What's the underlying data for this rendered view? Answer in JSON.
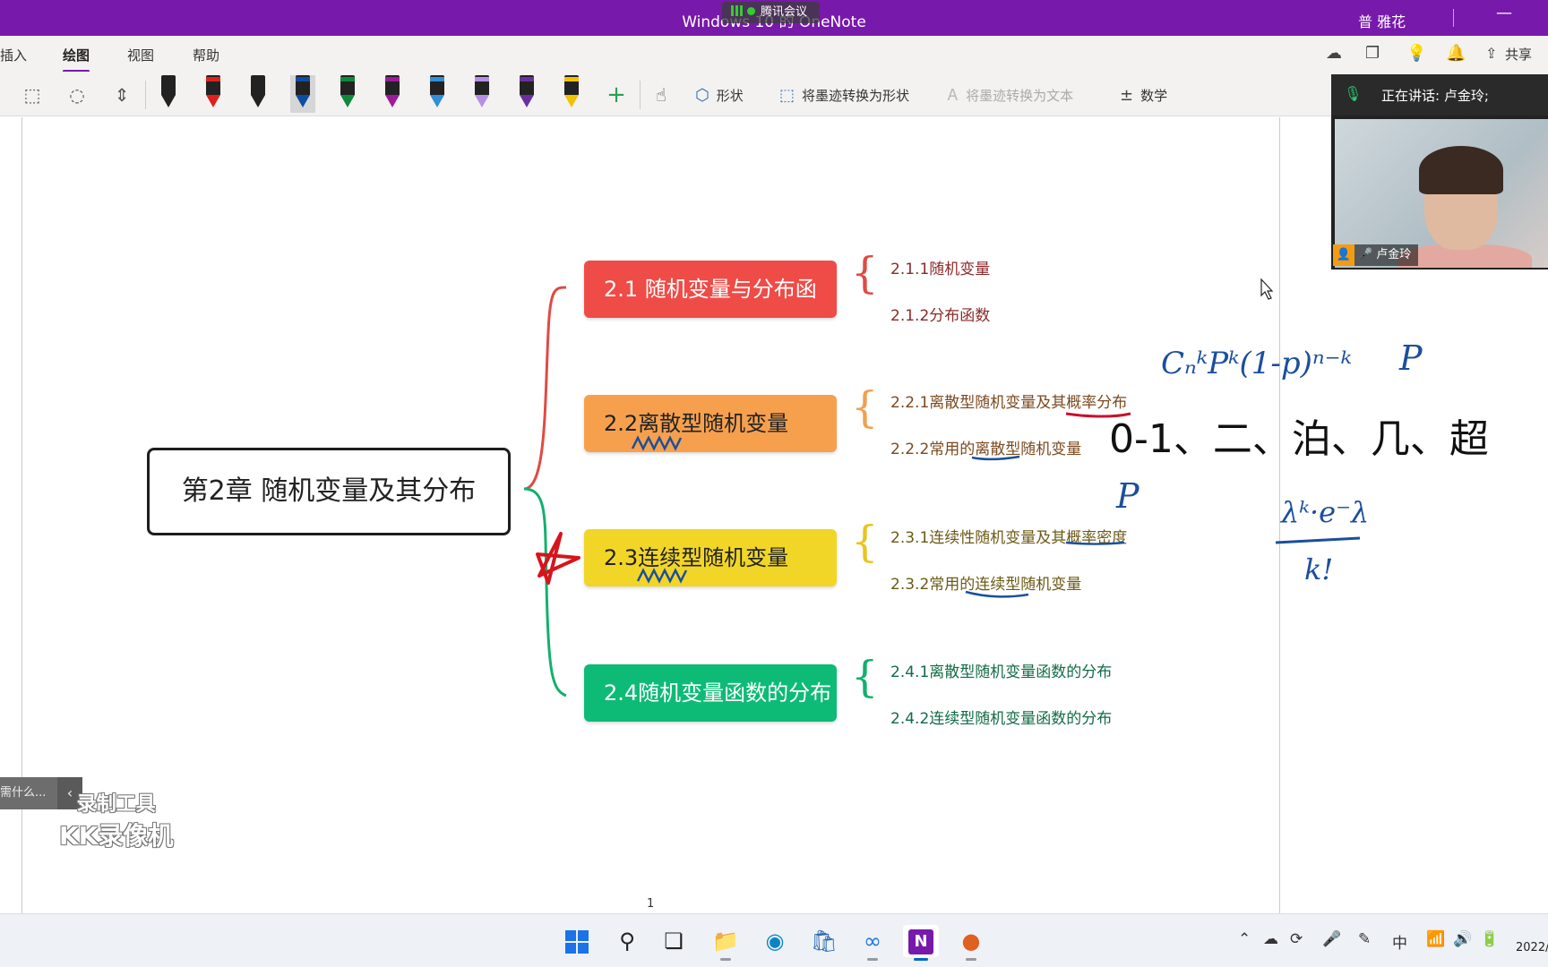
{
  "window": {
    "title": "Windows 10 的 OneNote",
    "meeting_badge": "腾讯会议",
    "user_name": "普 雅花",
    "minimize_icon": "minimize-icon"
  },
  "menu": {
    "tabs": [
      "插入",
      "绘图",
      "视图",
      "帮助"
    ],
    "active_tab": "绘图",
    "share_label": "共享"
  },
  "ribbon": {
    "pen_colors": [
      "#222222",
      "#e0201c",
      "#222222",
      "#0b4fa3",
      "#0e8a3a",
      "#9b1b9b",
      "#2f8fd8",
      "#b78ee6",
      "#6b2fa0",
      "#f2c200"
    ],
    "selected_pen_index": 3,
    "shapes_label": "形状",
    "ink_to_shape_label": "将墨迹转换为形状",
    "ink_to_text_label": "将墨迹转换为文本",
    "math_label": "数学"
  },
  "mindmap": {
    "root": "第2章 随机变量及其分布",
    "sections": [
      {
        "label": "2.1 随机变量与分布函数",
        "color": "#ef4b47",
        "subs": [
          "2.1.1随机变量",
          "2.1.2分布函数"
        ]
      },
      {
        "label": "2.2离散型随机变量",
        "color": "#f6a04d",
        "subs": [
          "2.2.1离散型随机变量及其概率分布",
          "2.2.2常用的离散型随机变量"
        ]
      },
      {
        "label": "2.3连续型随机变量",
        "color": "#f1d627",
        "subs": [
          "2.3.1连续性随机变量及其概率密度",
          "2.3.2常用的连续型随机变量"
        ]
      },
      {
        "label": "2.4随机变量函数的分布",
        "color": "#0dbb76",
        "subs": [
          "2.4.1离散型随机变量函数的分布",
          "2.4.2连续型随机变量函数的分布"
        ]
      }
    ]
  },
  "handwriting": {
    "binomial_formula": "CₙᵏPᵏ(1-p)ⁿ⁻ᵏ",
    "p_mark_1": "P",
    "distributions_line": "0-1、二、泊、几、超",
    "p_mark_2": "P",
    "poisson_numerator": "λᵏ·e⁻λ",
    "poisson_denominator": "k!"
  },
  "page": {
    "number": "1"
  },
  "video": {
    "speaking_label": "正在讲话: 卢金玲;",
    "participant_name": "卢金玲"
  },
  "sidetab": {
    "label": "需什么..."
  },
  "watermark": {
    "line1": "录制工具",
    "line2": "KK录像机"
  },
  "taskbar": {
    "apps": [
      "start-icon",
      "search-icon",
      "task-view-icon",
      "file-explorer-icon",
      "edge-icon",
      "store-icon",
      "tencent-meeting-icon",
      "onenote-icon",
      "kk-recorder-icon"
    ],
    "ime": "中",
    "clock": "2022/"
  }
}
